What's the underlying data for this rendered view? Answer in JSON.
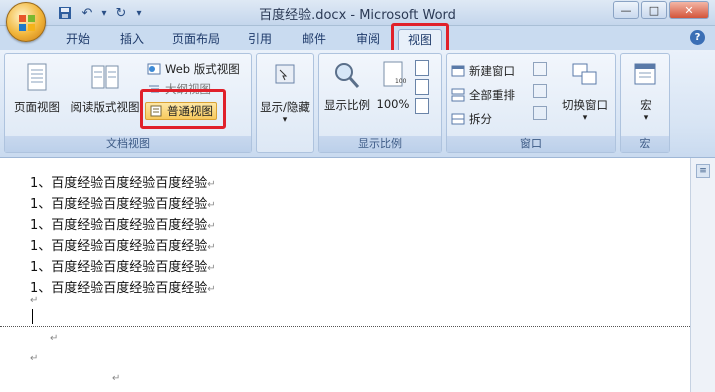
{
  "window": {
    "title": "百度经验.docx - Microsoft Word",
    "controls": {
      "minimize": "—",
      "maximize": "□",
      "close": "✕"
    }
  },
  "quick_access": {
    "save_icon": "save-icon",
    "undo_label": "↶",
    "undo_dropdown": "▾",
    "redo_label": "↻",
    "customize": "▾"
  },
  "tabs": [
    {
      "label": "开始"
    },
    {
      "label": "插入"
    },
    {
      "label": "页面布局"
    },
    {
      "label": "引用"
    },
    {
      "label": "邮件"
    },
    {
      "label": "审阅"
    },
    {
      "label": "视图"
    }
  ],
  "active_tab": "视图",
  "help_label": "?",
  "ribbon": {
    "doc_views": {
      "label": "文档视图",
      "page_view": "页面视图",
      "reading_view": "阅读版式视图",
      "web_view": "Web 版式视图",
      "outline_view": "大纲视图",
      "draft_view": "普通视图"
    },
    "show_hide": {
      "label": "显示/隐藏",
      "arrow": "▾"
    },
    "zoom": {
      "label": "显示比例",
      "zoom_button": "显示比例",
      "hundred_percent": "100%",
      "icon_100_text": "100"
    },
    "window": {
      "label": "窗口",
      "new_window": "新建窗口",
      "arrange_all": "全部重排",
      "split": "拆分",
      "switch_windows": "切换窗口",
      "arrow": "▾"
    },
    "macros": {
      "label": "宏",
      "button": "宏",
      "arrow": "▾"
    }
  },
  "document": {
    "lines": [
      "1、百度经验百度经验百度经验",
      "1、百度经验百度经验百度经验",
      "1、百度经验百度经验百度经验",
      "1、百度经验百度经验百度经验",
      "1、百度经验百度经验百度经验",
      "1、百度经验百度经验百度经验"
    ],
    "paragraph_mark": "↵"
  },
  "colors": {
    "highlight_box": "#e0202a",
    "ribbon_bg": "#dce7f5",
    "selected_button": "#f7c95d"
  }
}
